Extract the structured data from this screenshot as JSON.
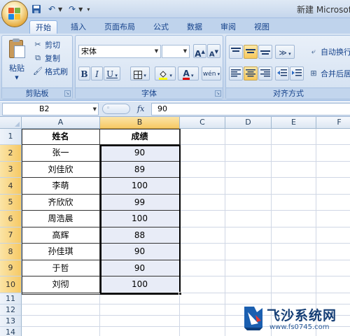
{
  "window": {
    "title": "新建 Microsoft"
  },
  "quick_access": [
    {
      "name": "save-icon",
      "glyph": "💾"
    },
    {
      "name": "undo-icon",
      "glyph": "↶"
    },
    {
      "name": "redo-icon",
      "glyph": "↷"
    }
  ],
  "tabs": [
    "开始",
    "插入",
    "页面布局",
    "公式",
    "数据",
    "审阅",
    "视图"
  ],
  "active_tab": "开始",
  "clipboard": {
    "group_label": "剪贴板",
    "paste_label": "粘贴",
    "cut_label": "剪切",
    "copy_label": "复制",
    "format_painter_label": "格式刷"
  },
  "font": {
    "group_label": "字体",
    "font_name": "宋体",
    "font_size": "",
    "grow_glyph": "A",
    "shrink_glyph": "A",
    "bold": "B",
    "italic": "I",
    "underline": "U",
    "font_color_glyph": "A",
    "phonetic_glyph": "wén"
  },
  "alignment": {
    "group_label": "对齐方式",
    "wrap_text_label": "自动换行",
    "merge_label": "合并后居"
  },
  "formula_bar": {
    "name_box": "B2",
    "fx": "fx",
    "value": "90"
  },
  "sheet": {
    "columns": [
      "A",
      "B",
      "C",
      "D",
      "E",
      "F"
    ],
    "selected_column": "B",
    "rows": [
      "1",
      "2",
      "3",
      "4",
      "5",
      "6",
      "7",
      "8",
      "9",
      "10",
      "11",
      "12",
      "13",
      "14"
    ],
    "headers": {
      "name": "姓名",
      "score": "成绩"
    },
    "records": [
      {
        "name": "张一",
        "score": "90"
      },
      {
        "name": "刘佳欣",
        "score": "89"
      },
      {
        "name": "李萌",
        "score": "100"
      },
      {
        "name": "齐欣欣",
        "score": "99"
      },
      {
        "name": "周浩晨",
        "score": "100"
      },
      {
        "name": "高辉",
        "score": "88"
      },
      {
        "name": "孙佳琪",
        "score": "90"
      },
      {
        "name": "于哲",
        "score": "90"
      },
      {
        "name": "刘彻",
        "score": "100"
      }
    ]
  },
  "watermark": {
    "title": "飞沙系统网",
    "url": "www.fs0745.com"
  },
  "colors": {
    "accent": "#15428b",
    "selection_header": "#f6c965",
    "selection_fill": "#e8ecf7"
  }
}
